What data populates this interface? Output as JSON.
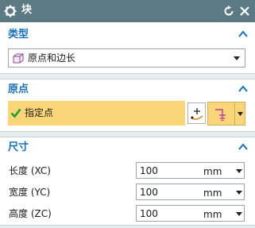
{
  "window": {
    "title": "块",
    "icons": [
      "gear-icon",
      "reset-icon",
      "close-icon"
    ]
  },
  "sections": {
    "type": {
      "label": "类型",
      "value": "原点和边长",
      "icon": "block-icon"
    },
    "origin": {
      "label": "原点",
      "specify_point": "指定点",
      "icons": [
        "check-icon",
        "point-dialog-icon",
        "inferred-point-icon"
      ]
    },
    "dimensions": {
      "label": "尺寸",
      "rows": [
        {
          "label": "长度 (XC)",
          "value": "100",
          "unit": "mm"
        },
        {
          "label": "宽度 (YC)",
          "value": "100",
          "unit": "mm"
        },
        {
          "label": "高度 (ZC)",
          "value": "100",
          "unit": "mm"
        }
      ]
    }
  },
  "colors": {
    "title_bar": "#5b7a84",
    "section_label": "#1a6fb7",
    "highlight": "#fbd678"
  }
}
